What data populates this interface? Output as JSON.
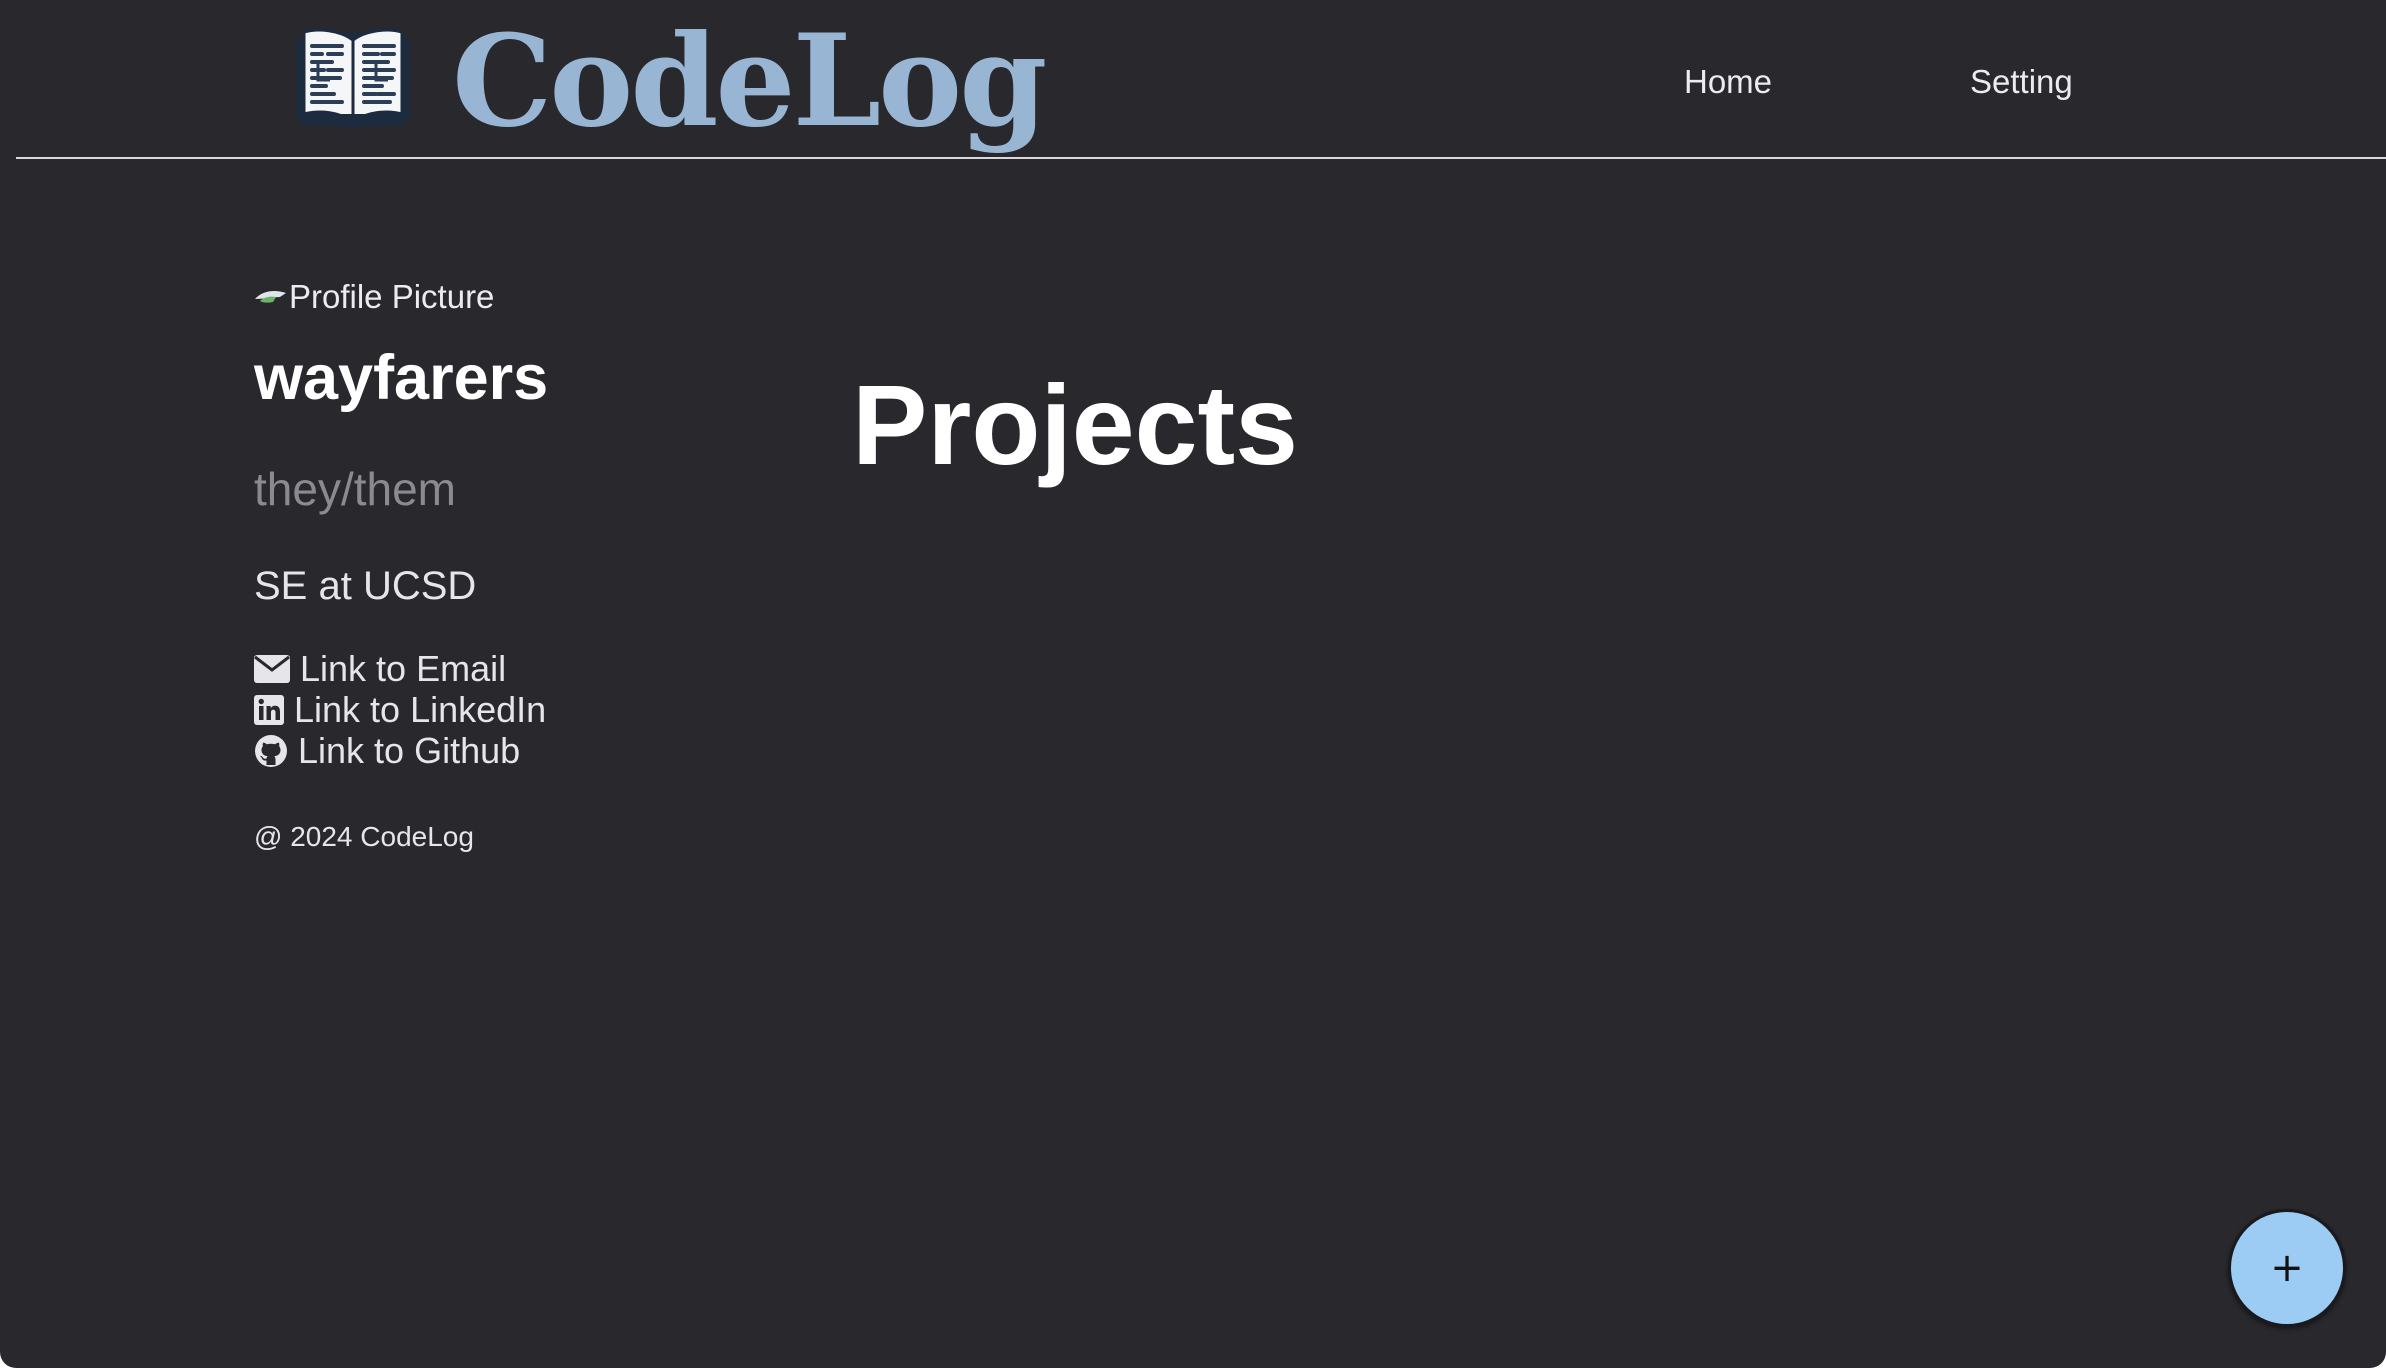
{
  "app": {
    "brand": "CodeLog",
    "logo_icon": "open-book-icon",
    "brand_color": "#98b6d4",
    "background_color": "#29282d"
  },
  "nav": {
    "items": [
      {
        "label": "Home"
      },
      {
        "label": "Setting"
      }
    ]
  },
  "profile": {
    "picture_alt": "Profile Picture",
    "username": "wayfarers",
    "pronouns": "they/them",
    "bio": "SE at UCSD",
    "links": [
      {
        "icon": "envelope-icon",
        "label": "Link to Email"
      },
      {
        "icon": "linkedin-icon",
        "label": "Link to LinkedIn"
      },
      {
        "icon": "github-icon",
        "label": "Link to Github"
      }
    ],
    "copyright": "@ 2024 CodeLog"
  },
  "main": {
    "title": "Projects"
  },
  "fab": {
    "label": "+",
    "icon": "plus-icon",
    "color": "#9ccbf4"
  }
}
